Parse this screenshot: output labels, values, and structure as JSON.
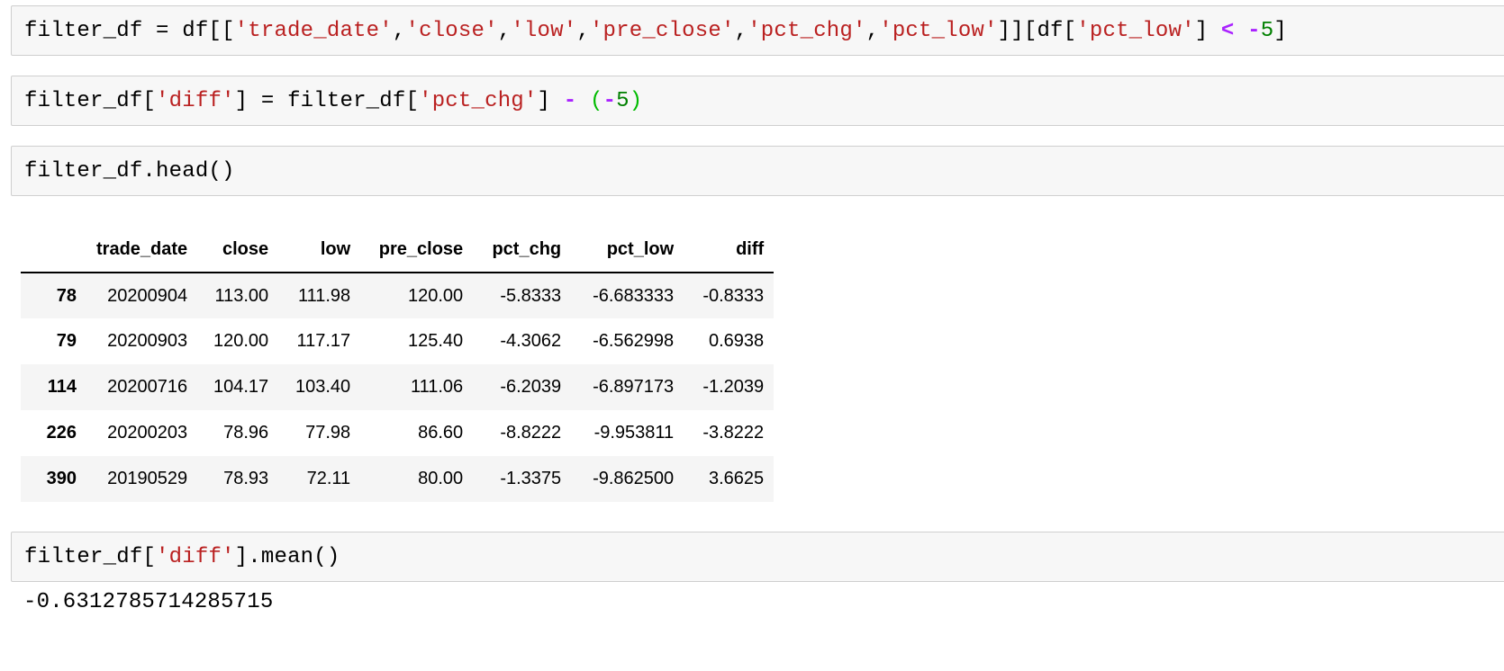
{
  "cells": [
    {
      "tokens": [
        {
          "t": "filter_df = df[[",
          "c": "plain"
        },
        {
          "t": "'trade_date'",
          "c": "str"
        },
        {
          "t": ",",
          "c": "plain"
        },
        {
          "t": "'close'",
          "c": "str"
        },
        {
          "t": ",",
          "c": "plain"
        },
        {
          "t": "'low'",
          "c": "str"
        },
        {
          "t": ",",
          "c": "plain"
        },
        {
          "t": "'pre_close'",
          "c": "str"
        },
        {
          "t": ",",
          "c": "plain"
        },
        {
          "t": "'pct_chg'",
          "c": "str"
        },
        {
          "t": ",",
          "c": "plain"
        },
        {
          "t": "'pct_low'",
          "c": "str"
        },
        {
          "t": "]][df[",
          "c": "plain"
        },
        {
          "t": "'pct_low'",
          "c": "str"
        },
        {
          "t": "] ",
          "c": "plain"
        },
        {
          "t": "<",
          "c": "op"
        },
        {
          "t": " ",
          "c": "plain"
        },
        {
          "t": "-",
          "c": "op"
        },
        {
          "t": "5",
          "c": "num"
        },
        {
          "t": "]",
          "c": "plain"
        }
      ]
    },
    {
      "tokens": [
        {
          "t": "filter_df[",
          "c": "plain"
        },
        {
          "t": "'diff'",
          "c": "str"
        },
        {
          "t": "] = filter_df[",
          "c": "plain"
        },
        {
          "t": "'pct_chg'",
          "c": "str"
        },
        {
          "t": "] ",
          "c": "plain"
        },
        {
          "t": "-",
          "c": "op"
        },
        {
          "t": " ",
          "c": "plain"
        },
        {
          "t": "(",
          "c": "par"
        },
        {
          "t": "-",
          "c": "op"
        },
        {
          "t": "5",
          "c": "num"
        },
        {
          "t": ")",
          "c": "par"
        }
      ]
    },
    {
      "tokens": [
        {
          "t": "filter_df.head()",
          "c": "plain"
        }
      ]
    },
    {
      "tokens": [
        {
          "t": "filter_df[",
          "c": "plain"
        },
        {
          "t": "'diff'",
          "c": "str"
        },
        {
          "t": "].mean()",
          "c": "plain"
        }
      ]
    }
  ],
  "table": {
    "columns": [
      "trade_date",
      "close",
      "low",
      "pre_close",
      "pct_chg",
      "pct_low",
      "diff"
    ],
    "rows": [
      {
        "index": "78",
        "values": [
          "20200904",
          "113.00",
          "111.98",
          "120.00",
          "-5.8333",
          "-6.683333",
          "-0.8333"
        ]
      },
      {
        "index": "79",
        "values": [
          "20200903",
          "120.00",
          "117.17",
          "125.40",
          "-4.3062",
          "-6.562998",
          "0.6938"
        ]
      },
      {
        "index": "114",
        "values": [
          "20200716",
          "104.17",
          "103.40",
          "111.06",
          "-6.2039",
          "-6.897173",
          "-1.2039"
        ]
      },
      {
        "index": "226",
        "values": [
          "20200203",
          "78.96",
          "77.98",
          "86.60",
          "-8.8222",
          "-9.953811",
          "-3.8222"
        ]
      },
      {
        "index": "390",
        "values": [
          "20190529",
          "78.93",
          "72.11",
          "80.00",
          "-1.3375",
          "-9.862500",
          "3.6625"
        ]
      }
    ]
  },
  "mean_output": "-0.6312785714285715"
}
